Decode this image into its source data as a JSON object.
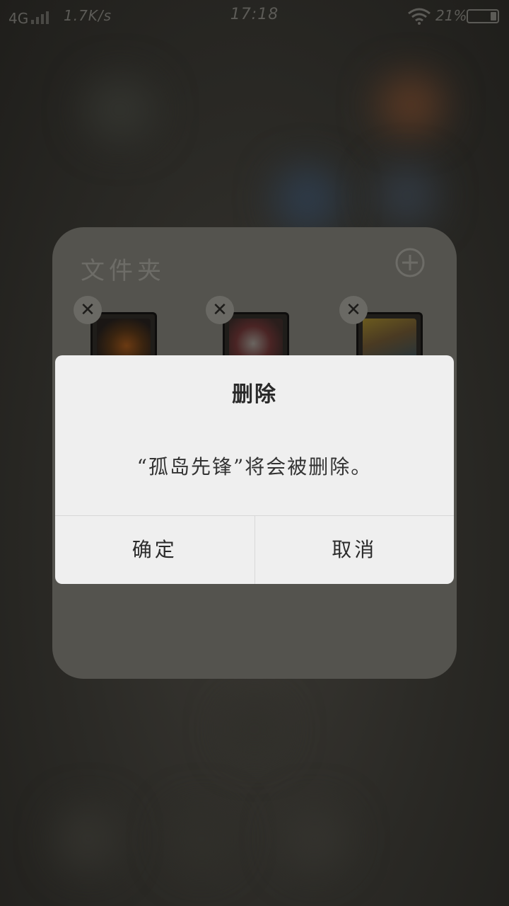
{
  "status_bar": {
    "network": "4G",
    "speed": "1.7K/s",
    "time": "17:18",
    "battery_text": "21%",
    "battery_level": 0.21
  },
  "folder": {
    "title": "文件夹",
    "apps": [
      {
        "icon": "dragon-eye-game-icon"
      },
      {
        "icon": "anime-character-game-icon"
      },
      {
        "icon": "monkey-king-game-icon"
      }
    ]
  },
  "dialog": {
    "title": "删除",
    "message": "“孤岛先锋”将会被删除。",
    "confirm_label": "确定",
    "cancel_label": "取消"
  },
  "colors": {
    "dialog_bg": "#efefef",
    "folder_bg": "#54534e",
    "scrim": "#2b2a26"
  }
}
